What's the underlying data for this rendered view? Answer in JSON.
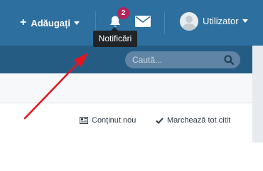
{
  "header": {
    "add_label": "Adăugați",
    "notification_count": "2",
    "username": "Utilizator"
  },
  "tooltip": {
    "text": "Notificări"
  },
  "search": {
    "placeholder": "Caută..."
  },
  "actions": {
    "new_content_label": "Conținut nou",
    "mark_read_label": "Marchează tot citit"
  },
  "colors": {
    "header_bg": "#2d6f9e",
    "subbar_bg": "#245c84",
    "badge": "#b6245a",
    "arrow": "#e8141c"
  }
}
